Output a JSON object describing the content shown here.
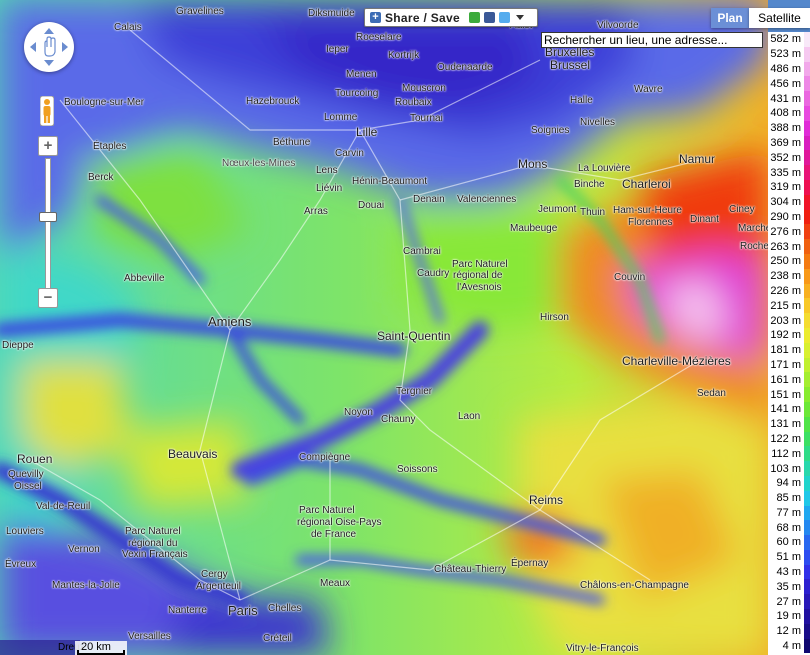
{
  "controls": {
    "share_label": "Share / Save",
    "search_value": "Rechercher un lieu, une adresse...",
    "map_types": {
      "plan": "Plan",
      "satellite": "Satellite",
      "active": "plan"
    },
    "scale_label": "20 km",
    "attribution": "Dreux"
  },
  "legend": [
    {
      "label": "582 m",
      "color": "#f8e8f8"
    },
    {
      "label": "523 m",
      "color": "#f6c8f0"
    },
    {
      "label": "486 m",
      "color": "#f2a8ea"
    },
    {
      "label": "456 m",
      "color": "#ee88e6"
    },
    {
      "label": "431 m",
      "color": "#ea68e0"
    },
    {
      "label": "408 m",
      "color": "#e84ae0"
    },
    {
      "label": "388 m",
      "color": "#e02cd8"
    },
    {
      "label": "369 m",
      "color": "#d81ec0"
    },
    {
      "label": "352 m",
      "color": "#e0189a"
    },
    {
      "label": "335 m",
      "color": "#e81478"
    },
    {
      "label": "319 m",
      "color": "#ee1050"
    },
    {
      "label": "304 m",
      "color": "#f01428"
    },
    {
      "label": "290 m",
      "color": "#f02010"
    },
    {
      "label": "276 m",
      "color": "#f04010"
    },
    {
      "label": "263 m",
      "color": "#f06010"
    },
    {
      "label": "250 m",
      "color": "#f47a10"
    },
    {
      "label": "238 m",
      "color": "#f89818"
    },
    {
      "label": "226 m",
      "color": "#f8b020"
    },
    {
      "label": "215 m",
      "color": "#f8c828"
    },
    {
      "label": "203 m",
      "color": "#f4dc30"
    },
    {
      "label": "192 m",
      "color": "#ecec30"
    },
    {
      "label": "181 m",
      "color": "#d8f030"
    },
    {
      "label": "171 m",
      "color": "#c0f030"
    },
    {
      "label": "161 m",
      "color": "#a4ee30"
    },
    {
      "label": "151 m",
      "color": "#88ec30"
    },
    {
      "label": "141 m",
      "color": "#6ce838"
    },
    {
      "label": "131 m",
      "color": "#50e448"
    },
    {
      "label": "122 m",
      "color": "#3ce064"
    },
    {
      "label": "112 m",
      "color": "#30dc88"
    },
    {
      "label": "103 m",
      "color": "#28d8ac"
    },
    {
      "label": "94 m",
      "color": "#20d4cc"
    },
    {
      "label": "85 m",
      "color": "#20c8e8"
    },
    {
      "label": "77 m",
      "color": "#20a8f0"
    },
    {
      "label": "68 m",
      "color": "#2488f0"
    },
    {
      "label": "60 m",
      "color": "#2868f0"
    },
    {
      "label": "51 m",
      "color": "#2c4cf0"
    },
    {
      "label": "43 m",
      "color": "#3030e8"
    },
    {
      "label": "35 m",
      "color": "#2c20d0"
    },
    {
      "label": "27 m",
      "color": "#2818b8"
    },
    {
      "label": "19 m",
      "color": "#2010a0"
    },
    {
      "label": "12 m",
      "color": "#180c88"
    },
    {
      "label": "4 m",
      "color": "#100870"
    }
  ],
  "places": [
    {
      "name": "Gravelines"
    },
    {
      "name": "Diksmuide"
    },
    {
      "name": "Calais"
    },
    {
      "name": "Roeselare"
    },
    {
      "name": "Aalst"
    },
    {
      "name": "Vilvoorde"
    },
    {
      "name": "Ieper"
    },
    {
      "name": "Kortrijk"
    },
    {
      "name": "Oudenaarde"
    },
    {
      "name": "Bruxelles"
    },
    {
      "name": "Brussel"
    },
    {
      "name": "Menen"
    },
    {
      "name": "Boulogne-sur-Mer"
    },
    {
      "name": "Hazebrouck"
    },
    {
      "name": "Tourcoing"
    },
    {
      "name": "Mouscron"
    },
    {
      "name": "Roubaix"
    },
    {
      "name": "Wavre"
    },
    {
      "name": "Halle"
    },
    {
      "name": "Lomme"
    },
    {
      "name": "Tournai"
    },
    {
      "name": "Lille"
    },
    {
      "name": "Soignies"
    },
    {
      "name": "Nivelles"
    },
    {
      "name": "Étaples"
    },
    {
      "name": "Béthune"
    },
    {
      "name": "Carvin"
    },
    {
      "name": "Mons"
    },
    {
      "name": "La Louvière"
    },
    {
      "name": "Namur"
    },
    {
      "name": "Nœux-les-Mines"
    },
    {
      "name": "Lens"
    },
    {
      "name": "Binche"
    },
    {
      "name": "Charleroi"
    },
    {
      "name": "Berck"
    },
    {
      "name": "Liévin"
    },
    {
      "name": "Hénin-Beaumont"
    },
    {
      "name": "Denain"
    },
    {
      "name": "Valenciennes"
    },
    {
      "name": "Arras"
    },
    {
      "name": "Douai"
    },
    {
      "name": "Jeumont"
    },
    {
      "name": "Thuin"
    },
    {
      "name": "Ham-sur-Heure"
    },
    {
      "name": "Florennes"
    },
    {
      "name": "Ciney"
    },
    {
      "name": "Dinant"
    },
    {
      "name": "Maubeuge"
    },
    {
      "name": "Marche"
    },
    {
      "name": "Rochefort"
    },
    {
      "name": "Cambrai"
    },
    {
      "name": "Parc Naturel"
    },
    {
      "name": "Caudry"
    },
    {
      "name": "régional de"
    },
    {
      "name": "l'Avesnois"
    },
    {
      "name": "Abbeville"
    },
    {
      "name": "Couvin"
    },
    {
      "name": "Amiens"
    },
    {
      "name": "Hirson"
    },
    {
      "name": "Saint-Quentin"
    },
    {
      "name": "Dieppe"
    },
    {
      "name": "Charleville-Mézières"
    },
    {
      "name": "Sedan"
    },
    {
      "name": "Tergnier"
    },
    {
      "name": "Chauny"
    },
    {
      "name": "Noyon"
    },
    {
      "name": "Laon"
    },
    {
      "name": "Rouen"
    },
    {
      "name": "Beauvais"
    },
    {
      "name": "Compiègne"
    },
    {
      "name": "Soissons"
    },
    {
      "name": "Quevilly"
    },
    {
      "name": "Oissel"
    },
    {
      "name": "Reims"
    },
    {
      "name": "Val-de-Reuil"
    },
    {
      "name": "Parc Naturel"
    },
    {
      "name": "régional Oise-Pays"
    },
    {
      "name": "de France"
    },
    {
      "name": "Louviers"
    },
    {
      "name": "Parc Naturel"
    },
    {
      "name": "régional du"
    },
    {
      "name": "Vexin Français"
    },
    {
      "name": "Vernon"
    },
    {
      "name": "Épernay"
    },
    {
      "name": "Évreux"
    },
    {
      "name": "Cergy"
    },
    {
      "name": "Argenteuil"
    },
    {
      "name": "Mantes-la-Jolie"
    },
    {
      "name": "Château-Thierry"
    },
    {
      "name": "Meaux"
    },
    {
      "name": "Châlons-en-Champagne"
    },
    {
      "name": "Nanterre"
    },
    {
      "name": "Paris"
    },
    {
      "name": "Chelles"
    },
    {
      "name": "Versailles"
    },
    {
      "name": "Créteil"
    },
    {
      "name": "Vitry-le-François"
    }
  ]
}
